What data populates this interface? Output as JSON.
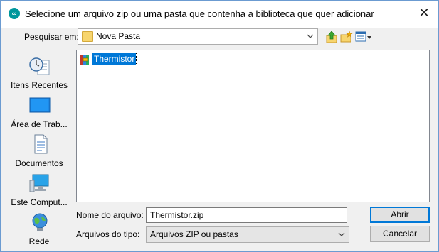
{
  "window": {
    "title": "Selecione um arquivo zip ou uma pasta que contenha a biblioteca que quer adicionar",
    "close_glyph": "✕"
  },
  "lookin": {
    "label": "Pesquisar em:",
    "value": "Nova Pasta"
  },
  "toolbar": {
    "up_icon": "folder-up-icon",
    "new_folder_icon": "new-folder-icon",
    "view_menu_icon": "view-menu-icon"
  },
  "places": [
    {
      "label": "Itens Recentes",
      "icon": "recent-items-icon"
    },
    {
      "label": "Área de Trab...",
      "icon": "desktop-icon"
    },
    {
      "label": "Documentos",
      "icon": "documents-icon"
    },
    {
      "label": "Este Comput...",
      "icon": "this-pc-icon"
    },
    {
      "label": "Rede",
      "icon": "network-icon"
    }
  ],
  "files": [
    {
      "name": "Thermistor",
      "icon": "zip-archive-icon",
      "selected": true
    }
  ],
  "filename": {
    "label": "Nome do arquivo:",
    "value": "Thermistor.zip"
  },
  "filetype": {
    "label": "Arquivos do tipo:",
    "value": "Arquivos ZIP ou pastas"
  },
  "buttons": {
    "open": "Abrir",
    "cancel": "Cancelar"
  },
  "colors": {
    "selection": "#0078d7",
    "accent_border": "#0078d7",
    "app_icon": "#00979c"
  }
}
